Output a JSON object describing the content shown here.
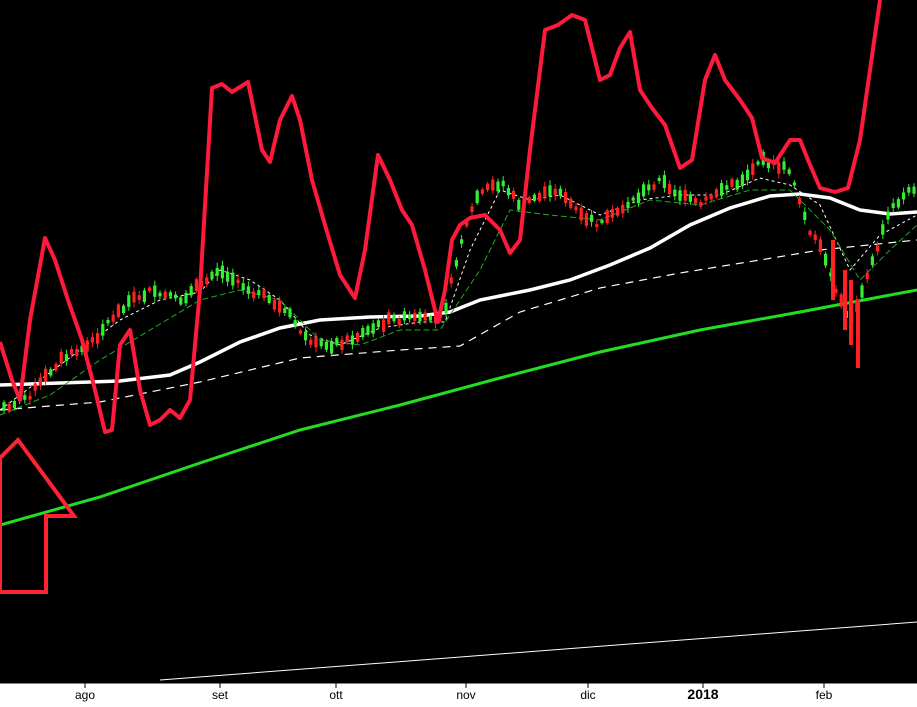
{
  "chart_data": {
    "type": "line",
    "title": "",
    "xlabel": "",
    "ylabel": "",
    "x_tick_labels": [
      {
        "label": "ago",
        "bold": false
      },
      {
        "label": "set",
        "bold": false
      },
      {
        "label": "ott",
        "bold": false
      },
      {
        "label": "nov",
        "bold": false
      },
      {
        "label": "dic",
        "bold": false
      },
      {
        "label": "2018",
        "bold": true
      },
      {
        "label": "feb",
        "bold": false
      }
    ],
    "colors": {
      "background": "#000000",
      "axis_band": "#ffffff",
      "oscillator": "#ff1a3c",
      "long_ma": "#22dd22",
      "mid_ma": "#ffffff",
      "up_candle": "#33ee33",
      "down_candle": "#ff2222",
      "arrow": "#ff2233"
    },
    "annotations": [
      {
        "type": "arrow",
        "direction": "up",
        "color": "#ff2233"
      }
    ]
  }
}
